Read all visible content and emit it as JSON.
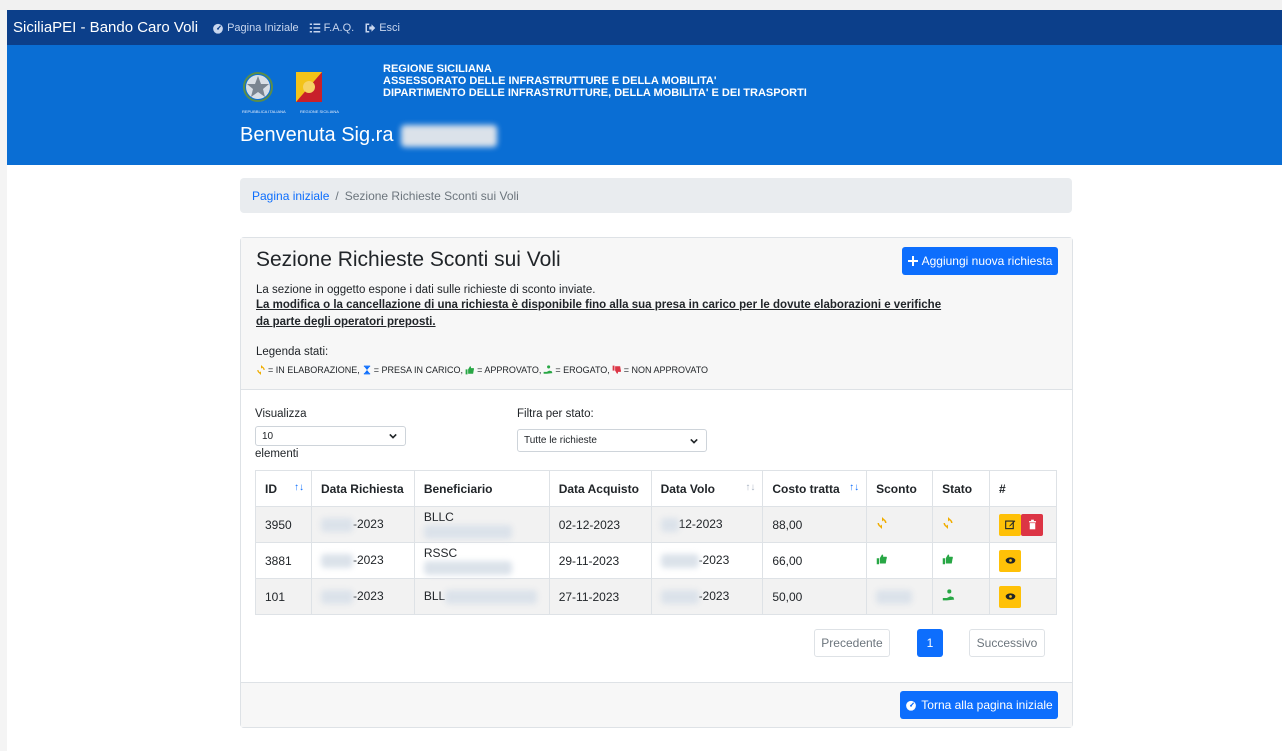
{
  "navbar": {
    "brand": "SiciliaPEI - Bando Caro Voli",
    "links": [
      {
        "label": "Pagina Iniziale",
        "icon": "dashboard-icon"
      },
      {
        "label": "F.A.Q.",
        "icon": "list-icon"
      },
      {
        "label": "Esci",
        "icon": "sign-out-icon"
      }
    ]
  },
  "header": {
    "emblem1_caption": "REPUBBLICA ITALIANA",
    "emblem2_caption": "REGIONE SICILIANA",
    "org_line1": "REGIONE SICILIANA",
    "org_line2": "ASSESSORATO DELLE INFRASTRUTTURE E DELLA MOBILITA'",
    "org_line3": "DIPARTIMENTO DELLE INFRASTRUTTURE, DELLA MOBILITA' E DEI TRASPORTI",
    "welcome": "Benvenuta Sig.ra"
  },
  "breadcrumb": {
    "home": "Pagina iniziale",
    "separator": "/",
    "current": "Sezione Richieste Sconti sui Voli"
  },
  "section": {
    "title": "Sezione Richieste Sconti sui Voli",
    "add_button": "Aggiungi nuova richiesta",
    "description": "La sezione in oggetto espone i dati sulle richieste di sconto inviate.",
    "warning": "La modifica o la cancellazione di una richiesta è disponibile fino alla sua presa in carico per le dovute elaborazioni e verifiche da parte degli operatori preposti.",
    "legend_title": "Legenda stati:",
    "legend": [
      {
        "text": "= IN ELABORAZIONE,",
        "icon": "refresh-icon",
        "color": "#f0ad00"
      },
      {
        "text": "= PRESA IN CARICO,",
        "icon": "hourglass-icon",
        "color": "#0d6efd"
      },
      {
        "text": "= APPROVATO,",
        "icon": "thumbs-up-icon",
        "color": "#28a745"
      },
      {
        "text": "= EROGATO,",
        "icon": "hand-coin-icon",
        "color": "#28a745"
      },
      {
        "text": "= NON APPROVATO",
        "icon": "thumbs-down-icon",
        "color": "#dc3545"
      }
    ]
  },
  "controls": {
    "show_label": "Visualizza",
    "show_value": "10",
    "show_suffix": "elementi",
    "filter_label": "Filtra per stato:",
    "filter_value": "Tutte le richieste"
  },
  "table": {
    "headers": [
      "ID",
      "Data Richiesta",
      "Beneficiario",
      "Data Acquisto",
      "Data Volo",
      "Costo tratta",
      "Sconto",
      "Stato",
      "#"
    ],
    "rows": [
      {
        "id": "3950",
        "data_richiesta": "-2023",
        "beneficiario": "BLLC",
        "data_acquisto": "02-12-2023",
        "data_volo": "12-2023",
        "costo": "88,00",
        "sconto": "refresh-icon",
        "stato": "refresh-icon",
        "actions": [
          "edit-icon",
          "delete-icon"
        ]
      },
      {
        "id": "3881",
        "data_richiesta": "-2023",
        "beneficiario": "RSSC",
        "data_acquisto": "29-11-2023",
        "data_volo": "-2023",
        "costo": "66,00",
        "sconto": "thumbs-up-icon",
        "stato": "thumbs-up-icon",
        "actions": [
          "view-icon"
        ]
      },
      {
        "id": "101",
        "data_richiesta": "-2023",
        "beneficiario": "BLL",
        "data_acquisto": "27-11-2023",
        "data_volo": "-2023",
        "costo": "50,00",
        "sconto": "",
        "stato": "hand-coin-icon",
        "actions": [
          "view-icon"
        ]
      }
    ]
  },
  "pagination": {
    "prev": "Precedente",
    "current": "1",
    "next": "Successivo"
  },
  "footer": {
    "back_button": "Torna alla pagina iniziale"
  },
  "colors": {
    "navbar": "#0c3f8a",
    "hero": "#0a6ed4",
    "primary": "#0d6efd",
    "warning": "#ffc107",
    "danger": "#dc3545",
    "success": "#28a745"
  }
}
